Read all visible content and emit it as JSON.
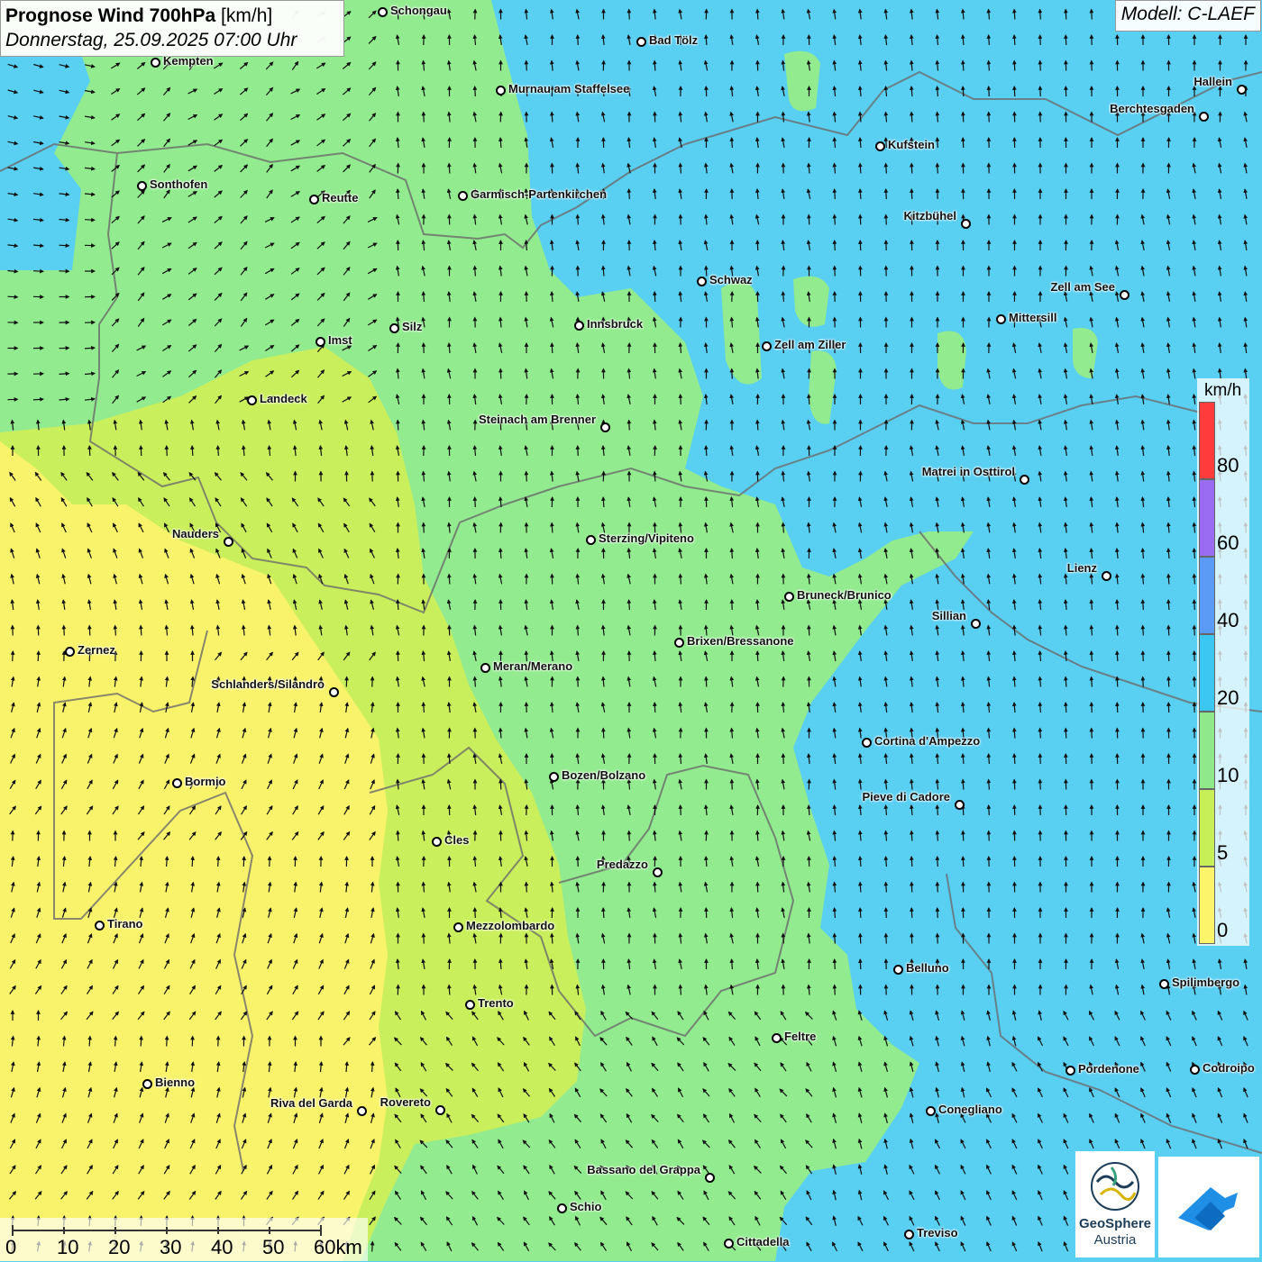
{
  "title": {
    "main": "Prognose Wind 700hPa",
    "unit": "[km/h]",
    "datetime": "Donnerstag, 25.09.2025 07:00 Uhr"
  },
  "model": "Modell: C-LAEF",
  "legend": {
    "unit": "km/h",
    "ticks": [
      "80",
      "60",
      "40",
      "20",
      "10",
      "5",
      "0"
    ],
    "colors": [
      "#ff3b3b",
      "#9a6cf0",
      "#5b9af5",
      "#3cc6f2",
      "#8fe889",
      "#c7ef57",
      "#fcf46a"
    ]
  },
  "scale": {
    "labels": [
      "0",
      "10",
      "20",
      "30",
      "40",
      "50",
      "60km"
    ]
  },
  "logo": {
    "name": "GeoSphere",
    "sub": "Austria",
    "icon": "geosphere-logo-icon",
    "app_icon": "cloud-arrow-app-icon"
  },
  "cities": [
    {
      "name": "Schongau"
    },
    {
      "name": "Bad Tölz"
    },
    {
      "name": "Kempten"
    },
    {
      "name": "Murnau am Staffelsee"
    },
    {
      "name": "Hallein"
    },
    {
      "name": "Berchtesgaden"
    },
    {
      "name": "Kufstein"
    },
    {
      "name": "Sonthofen"
    },
    {
      "name": "Reutte"
    },
    {
      "name": "Garmisch-Partenkirchen"
    },
    {
      "name": "Kitzbühel"
    },
    {
      "name": "Schwaz"
    },
    {
      "name": "Zell am See"
    },
    {
      "name": "Mittersill"
    },
    {
      "name": "Innsbruck"
    },
    {
      "name": "Imst"
    },
    {
      "name": "Silz"
    },
    {
      "name": "Zell am Ziller"
    },
    {
      "name": "Landeck"
    },
    {
      "name": "Steinach am Brenner"
    },
    {
      "name": "Matrei in Osttirol"
    },
    {
      "name": "Nauders"
    },
    {
      "name": "Sterzing/Vipiteno"
    },
    {
      "name": "Lienz"
    },
    {
      "name": "Bruneck/Brunico"
    },
    {
      "name": "Sillian"
    },
    {
      "name": "Zernez"
    },
    {
      "name": "Brixen/Bressanone"
    },
    {
      "name": "Meran/Merano"
    },
    {
      "name": "Schlanders/Silandro"
    },
    {
      "name": "Cortina d'Ampezzo"
    },
    {
      "name": "Bozen/Bolzano"
    },
    {
      "name": "Bormio"
    },
    {
      "name": "Pieve di Cadore"
    },
    {
      "name": "Cles"
    },
    {
      "name": "Predazzo"
    },
    {
      "name": "Tirano"
    },
    {
      "name": "Mezzolombardo"
    },
    {
      "name": "Belluno"
    },
    {
      "name": "Spilimbergo"
    },
    {
      "name": "Trento"
    },
    {
      "name": "Feltre"
    },
    {
      "name": "Bienno"
    },
    {
      "name": "Pordenone"
    },
    {
      "name": "Codroipo"
    },
    {
      "name": "Riva del Garda"
    },
    {
      "name": "Rovereto"
    },
    {
      "name": "Conegliano"
    },
    {
      "name": "Bassano del Grappa"
    },
    {
      "name": "Schio"
    },
    {
      "name": "Treviso"
    },
    {
      "name": "Cittadella"
    }
  ]
}
